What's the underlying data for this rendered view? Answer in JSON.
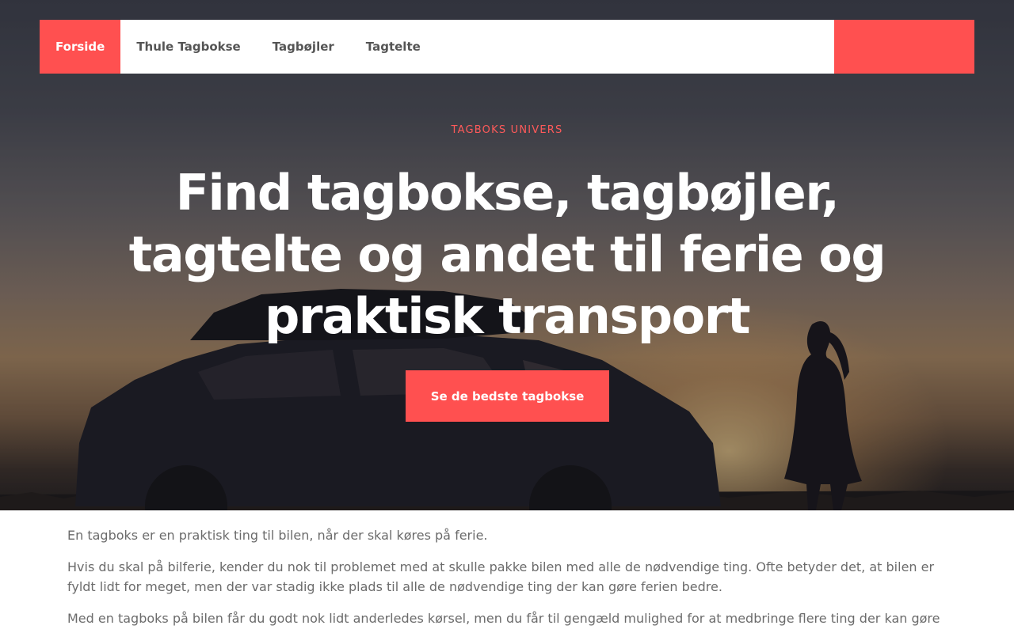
{
  "nav": {
    "items": [
      {
        "label": "Forside",
        "active": true
      },
      {
        "label": "Thule Tagbokse",
        "active": false
      },
      {
        "label": "Tagbøjler",
        "active": false
      },
      {
        "label": "Tagtelte",
        "active": false
      }
    ]
  },
  "hero": {
    "eyebrow": "TAGBOKS UNIVERS",
    "title": "Find tagbokse, tagbøjler, tagtelte og andet til ferie og praktisk transport",
    "cta_label": "Se de bedste tagbokse"
  },
  "content": {
    "paragraphs": [
      "En tagboks er en praktisk ting til bilen, når der skal køres på ferie.",
      "Hvis du skal på bilferie, kender du nok til problemet med at skulle pakke bilen med alle de nødvendige ting. Ofte betyder det, at bilen er fyldt lidt for meget, men der var stadig ikke plads til alle de nødvendige ting der kan gøre ferien bedre.",
      "Med en tagboks på bilen får du godt nok lidt anderledes kørsel, men du får til gengæld mulighed for at medbringe flere ting der kan gøre ferien"
    ]
  },
  "colors": {
    "accent": "#ff5050",
    "nav_text": "#555555",
    "body_text": "#6b6b6b"
  }
}
